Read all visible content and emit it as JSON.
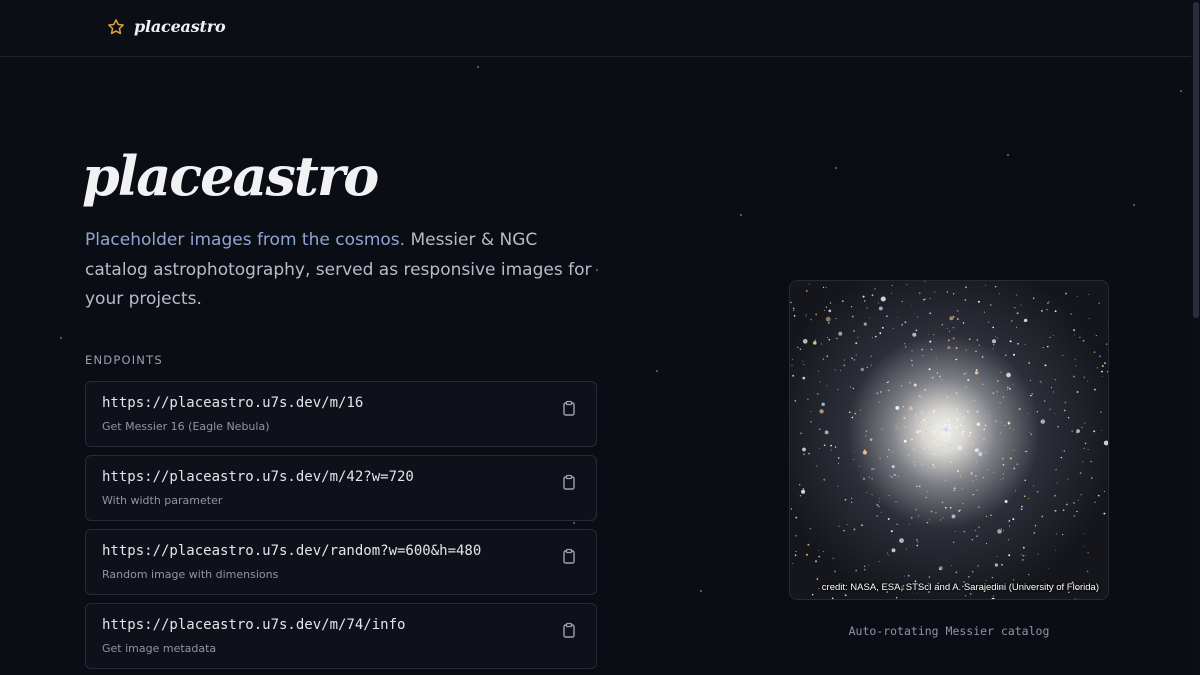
{
  "header": {
    "brand_icon": "star-outline-icon",
    "brand_name": "placeastro"
  },
  "hero": {
    "title": "placeastro",
    "description_lead": "Placeholder images from the cosmos.",
    "description_rest": " Messier & NGC catalog astrophotography, served as responsive images for your projects."
  },
  "endpoints": {
    "label": "ENDPOINTS",
    "items": [
      {
        "url": "https://placeastro.u7s.dev/m/16",
        "description": "Get Messier 16 (Eagle Nebula)"
      },
      {
        "url": "https://placeastro.u7s.dev/m/42?w=720",
        "description": "With width parameter"
      },
      {
        "url": "https://placeastro.u7s.dev/random?w=600&h=480",
        "description": "Random image with dimensions"
      },
      {
        "url": "https://placeastro.u7s.dev/m/74/info",
        "description": "Get image metadata"
      }
    ],
    "copy_icon": "clipboard-icon"
  },
  "preview": {
    "credit": "credit: NASA, ESA, STScI and A. Sarajedini (University of Florida)",
    "caption": "Auto-rotating Messier catalog"
  },
  "colors": {
    "background": "#0b0d14",
    "accent_star": "#e0a13a",
    "lead_text": "#8fa6d2"
  }
}
